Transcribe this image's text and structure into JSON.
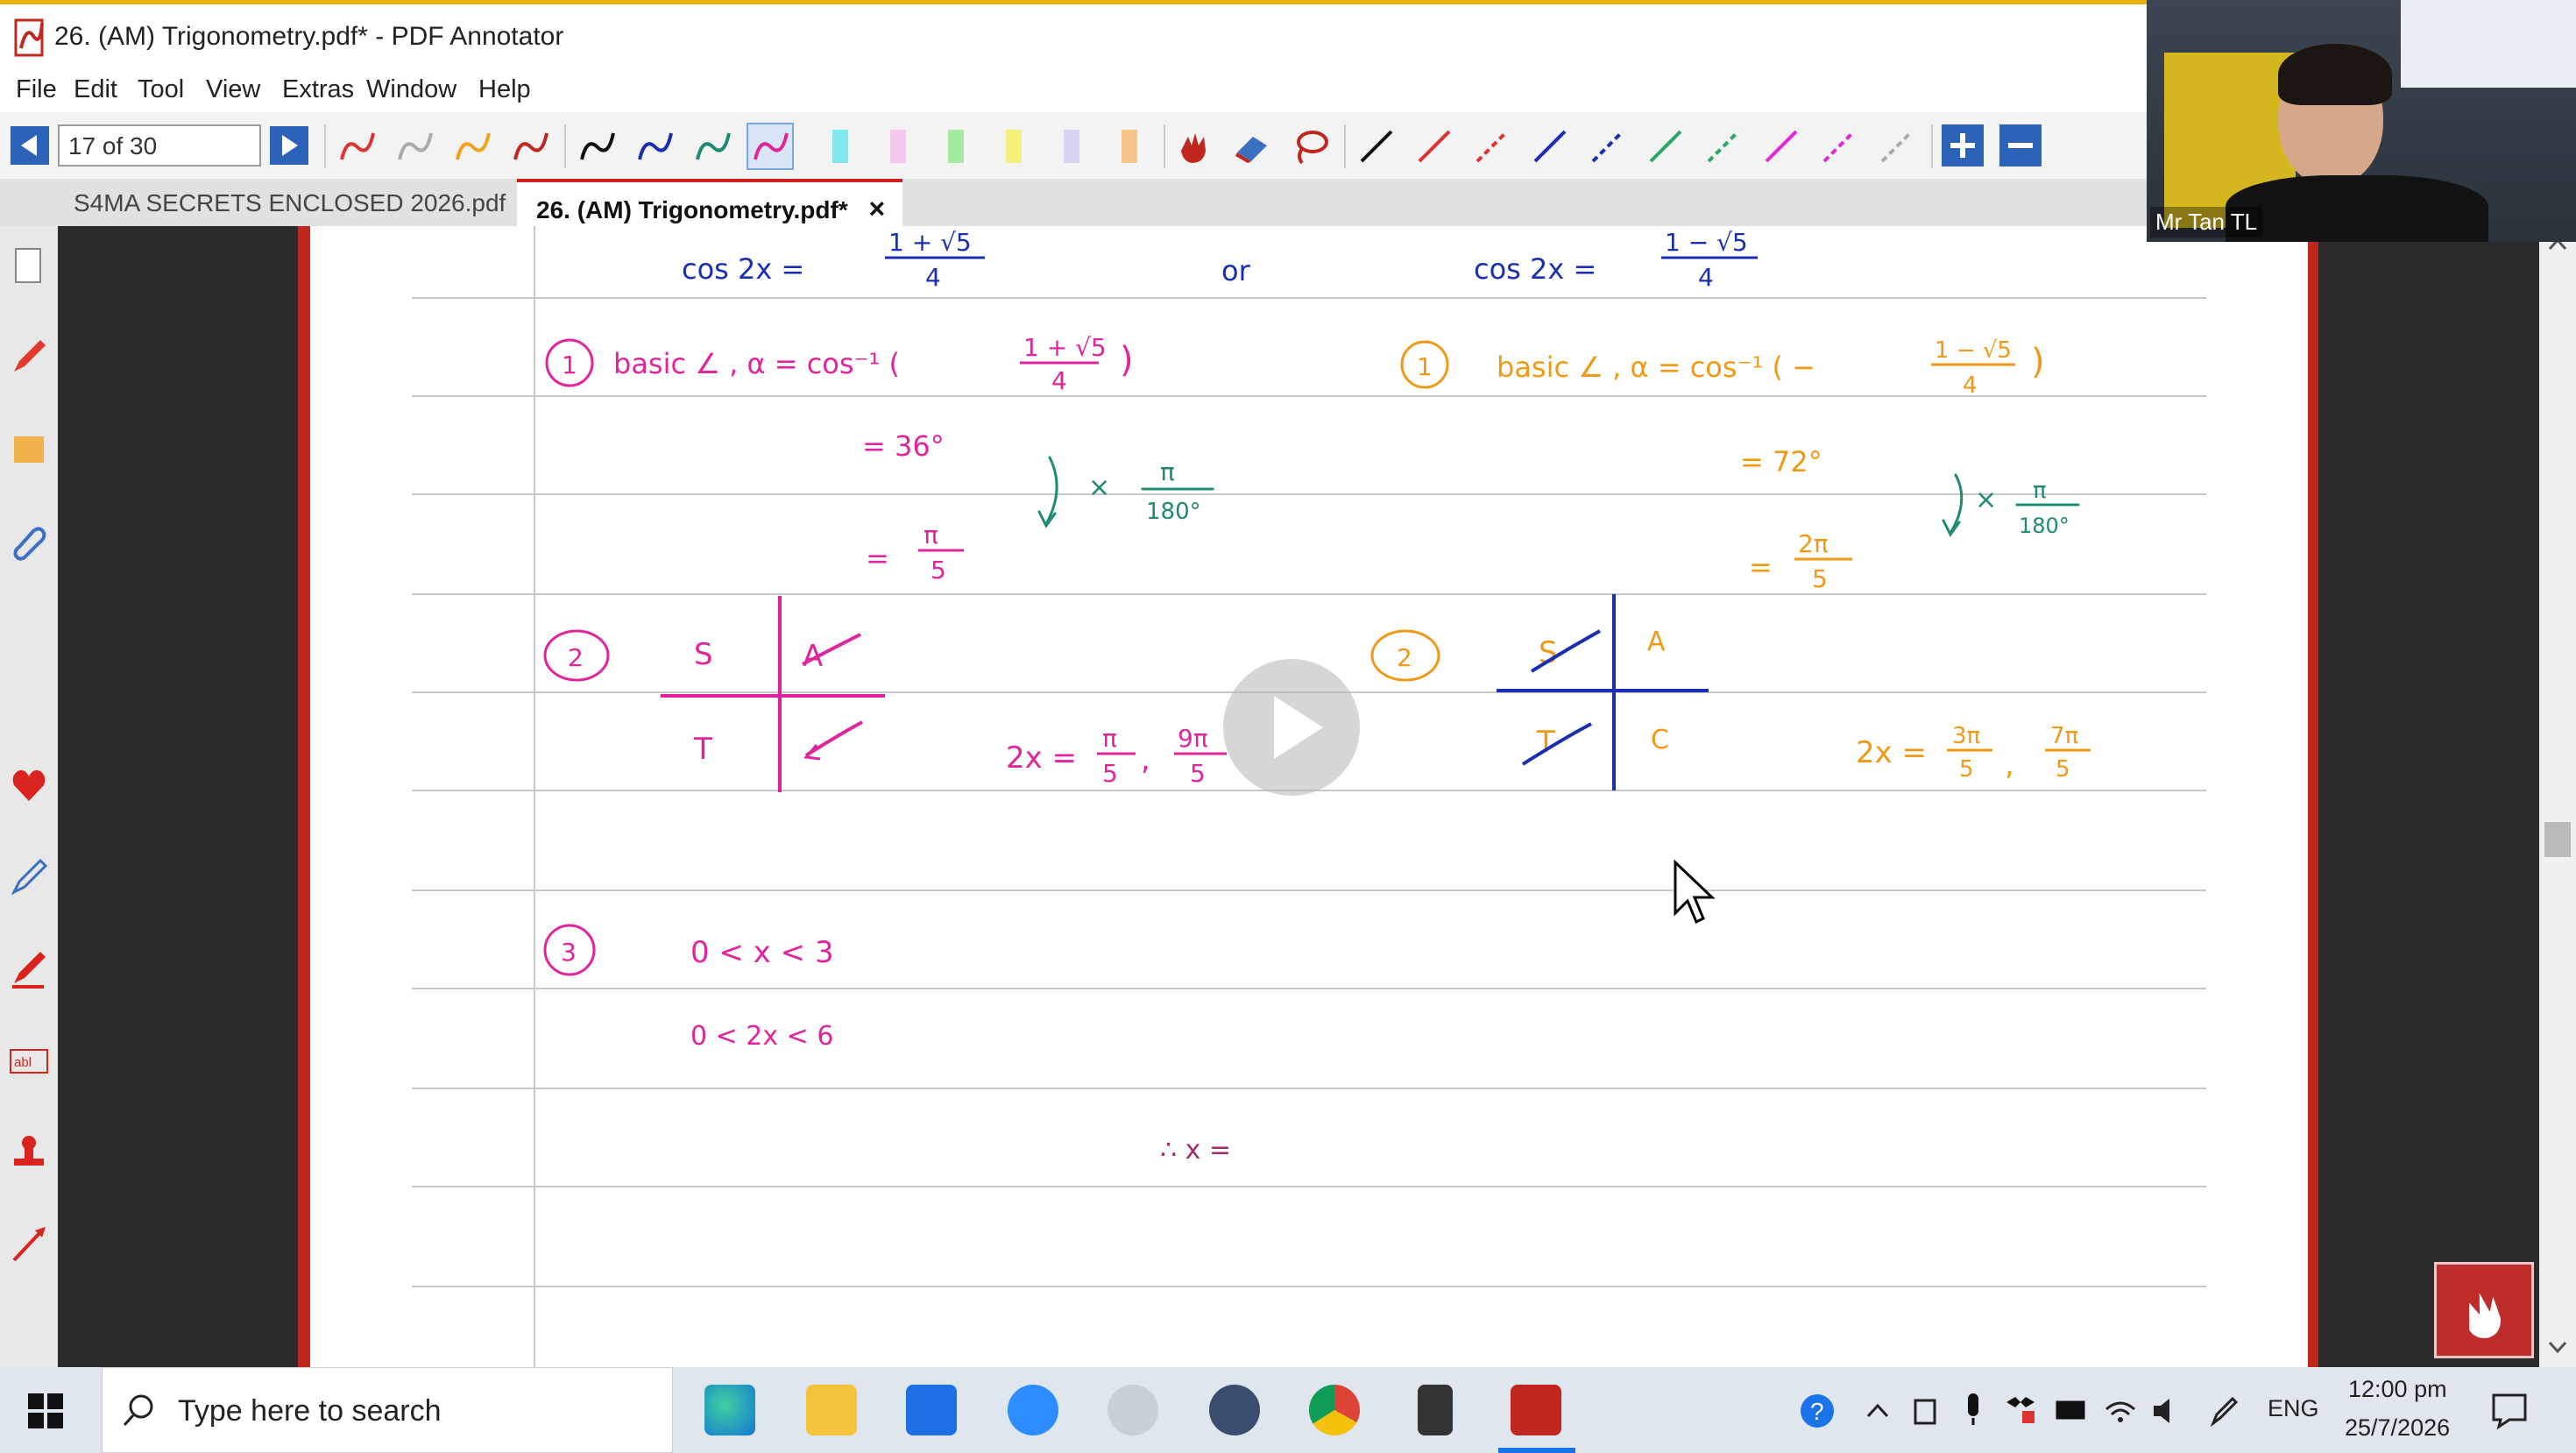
{
  "window": {
    "title": "26. (AM) Trigonometry.pdf* - PDF Annotator"
  },
  "menu": [
    "File",
    "Edit",
    "Tool",
    "View",
    "Extras",
    "Window",
    "Help"
  ],
  "toolbar": {
    "page_indicator": "17 of 30",
    "prev_icon": "previous-page-icon",
    "next_icon": "next-page-icon"
  },
  "tabs": [
    {
      "label": "S4MA SECRETS ENCLOSED 2026.pdf",
      "active": false
    },
    {
      "label": "26. (AM) Trigonometry.pdf*",
      "active": true,
      "close": "×"
    }
  ],
  "webcam": {
    "name": "Mr Tan TL"
  },
  "notes": {
    "row1": {
      "left_lhs": "cos 2x =",
      "left_num": "1 + √5",
      "left_den": "4",
      "or": "or",
      "right_lhs": "cos 2x =",
      "right_num": "1 − √5",
      "right_den": "4"
    },
    "step1_left": {
      "circle": "1",
      "text": "basic ∠ , α = cos⁻¹ (",
      "num": "1 + √5",
      "den": "4",
      "close": ")"
    },
    "step1_right": {
      "circle": "1",
      "text": "basic ∠ , α = cos⁻¹ ( −",
      "num": "1 − √5",
      "den": "4",
      "close": ")"
    },
    "deg_left": "= 36°",
    "deg_right": "= 72°",
    "conv_left": {
      "mult": "× ",
      "num": "π",
      "den": "180°"
    },
    "conv_right": {
      "mult": "× ",
      "num": "π",
      "den": "180°"
    },
    "rad_left": {
      "eq": "=",
      "num": "π",
      "den": "5"
    },
    "rad_right": {
      "eq": "=",
      "num": "2π",
      "den": "5"
    },
    "step2_left": {
      "circle": "2",
      "S": "S",
      "A": "A",
      "T": "T"
    },
    "step2_right": {
      "circle": "2",
      "S": "S",
      "A": "A",
      "T": "T",
      "C": "C"
    },
    "ans_left": {
      "lhs": "2x =",
      "n1": "π",
      "d1": "5",
      "sep": ",",
      "n2": "9π",
      "d2": "5"
    },
    "ans_right": {
      "lhs": "2x =",
      "n1": "3π",
      "d1": "5",
      "sep": ",",
      "n2": "7π",
      "d2": "5"
    },
    "step3": {
      "circle": "3",
      "line1": "0 <  x  < 3",
      "line2": "0 < 2x < 6",
      "therefore": "∴  x ="
    }
  },
  "taskbar": {
    "search_placeholder": "Type here to search",
    "lang": "ENG",
    "time": "12:00 pm",
    "date": "25/7/2026",
    "apps": [
      "edge-icon",
      "file-explorer-icon",
      "dropbox-icon",
      "zoom-icon",
      "clock-app-icon",
      "media-player-icon",
      "chrome-icon",
      "calculator-icon",
      "pdf-annotator-icon"
    ]
  },
  "colors": {
    "accent": "#2c62b8",
    "ink_blue": "#1a2fb0",
    "ink_pink": "#e0259c",
    "ink_orange": "#ef9a17",
    "ink_green": "#1f8a72",
    "red": "#c0281f"
  }
}
